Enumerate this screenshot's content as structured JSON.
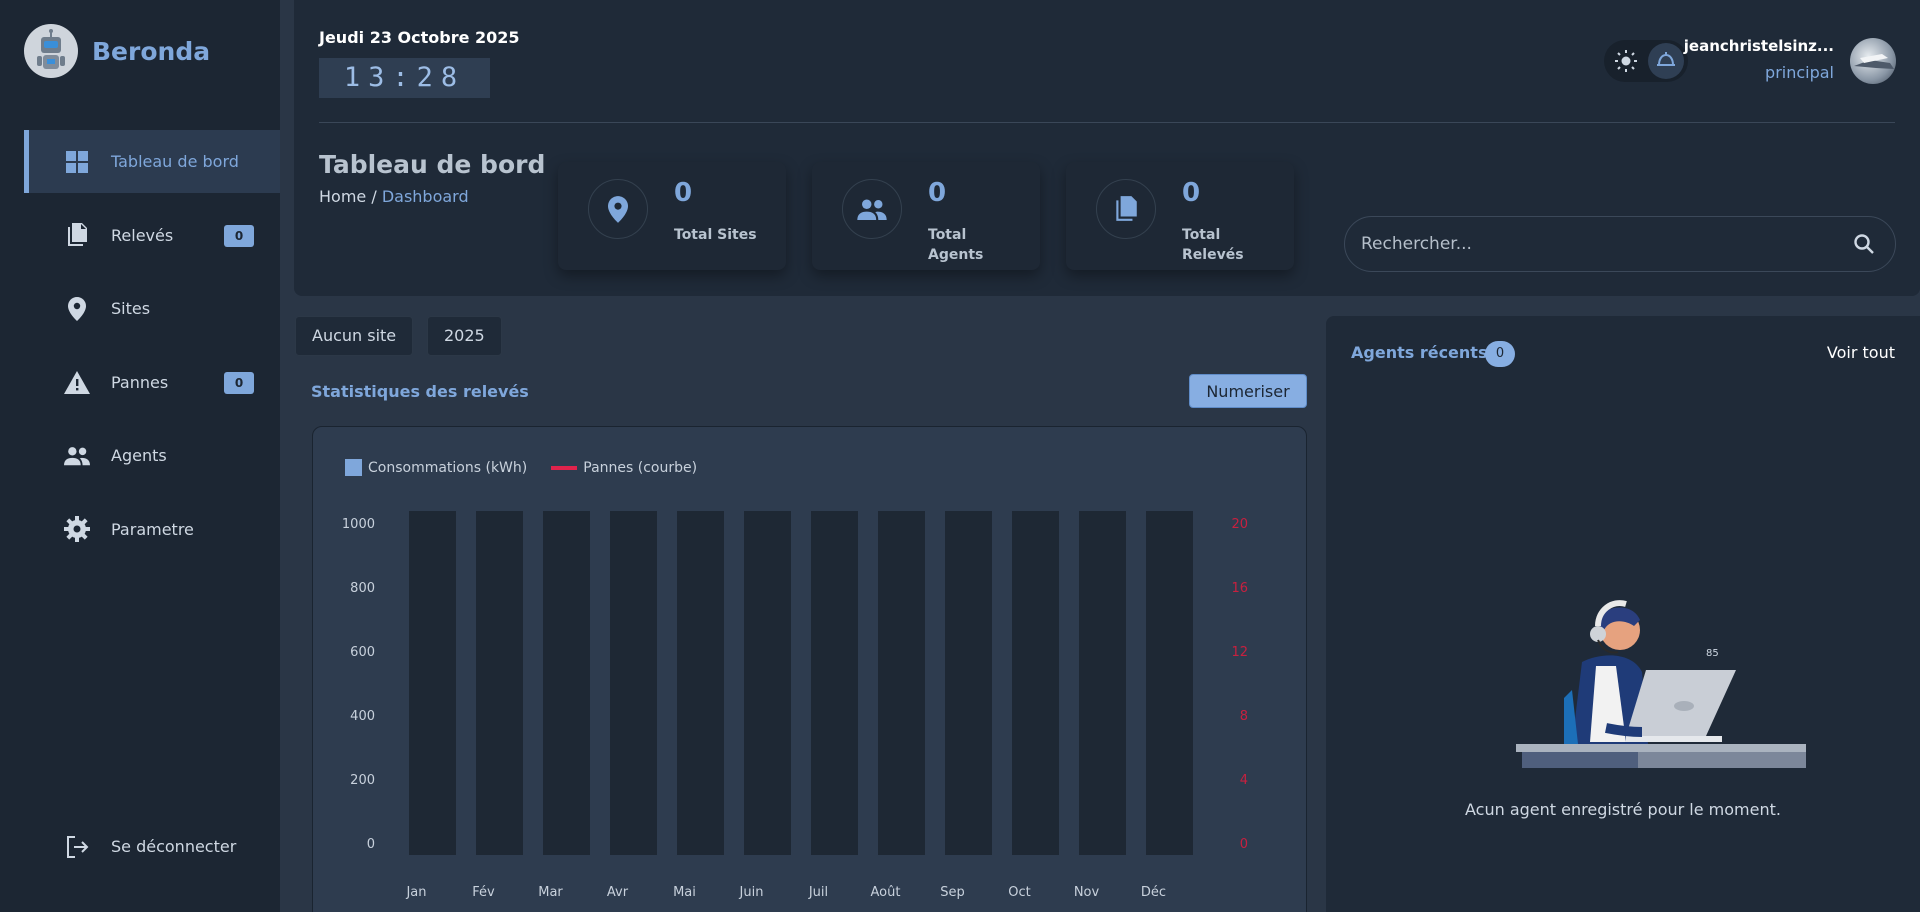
{
  "brand": {
    "name": "Beronda"
  },
  "sidebar": {
    "items": [
      {
        "label": "Tableau de bord",
        "active": true
      },
      {
        "label": "Relevés",
        "badge": "0"
      },
      {
        "label": "Sites"
      },
      {
        "label": "Pannes",
        "badge": "0"
      },
      {
        "label": "Agents"
      },
      {
        "label": "Parametre"
      }
    ],
    "logout": "Se déconnecter"
  },
  "header": {
    "date": "Jeudi 23 Octobre 2025",
    "time": "13:28",
    "user_name": "jeanchristelsinz...",
    "user_role": "principal",
    "page_title": "Tableau de bord",
    "breadcrumb": {
      "home": "Home",
      "sep": " / ",
      "current": "Dashboard"
    }
  },
  "stats": [
    {
      "value": "0",
      "label": "Total Sites",
      "icon": "location-icon"
    },
    {
      "value": "0",
      "label": "Total Agents",
      "icon": "people-icon"
    },
    {
      "value": "0",
      "label": "Total Relevés",
      "icon": "document-icon"
    }
  ],
  "search": {
    "placeholder": "Rechercher..."
  },
  "filters": {
    "site": "Aucun site",
    "year": "2025"
  },
  "section": {
    "stats_title": "Statistiques des relevés",
    "numeriser": "Numeriser"
  },
  "chart_data": {
    "type": "bar",
    "categories": [
      "Jan",
      "Fév",
      "Mar",
      "Avr",
      "Mai",
      "Juin",
      "Juil",
      "Août",
      "Sep",
      "Oct",
      "Nov",
      "Déc"
    ],
    "series": [
      {
        "name": "Consommations (kWh)",
        "values": [
          0,
          0,
          0,
          0,
          0,
          0,
          0,
          0,
          0,
          0,
          0,
          0
        ],
        "axis": "left"
      },
      {
        "name": "Pannes (courbe)",
        "values": [
          0,
          0,
          0,
          0,
          0,
          0,
          0,
          0,
          0,
          0,
          0,
          0
        ],
        "axis": "right"
      }
    ],
    "ylim": [
      0,
      1000
    ],
    "yticks": [
      "0",
      "200",
      "400",
      "600",
      "800",
      "1000"
    ],
    "y2lim": [
      0,
      20
    ],
    "y2ticks": [
      "0",
      "4",
      "8",
      "12",
      "16",
      "20"
    ],
    "legend": "top-left",
    "colors": {
      "bars": "#7fa7db",
      "line": "#e0234c",
      "bar_track": "#1e2834"
    }
  },
  "agents": {
    "title": "Agents récents",
    "count": "0",
    "voir_tout": "Voir tout",
    "empty_message": "Acun agent enregistré pour le moment.",
    "illustration_tag": "85"
  },
  "colors": {
    "accent": "#7fa7db",
    "sidebar_bg": "#1c2633",
    "panel_bg": "#1f2a38",
    "page_bg": "#2a3646"
  }
}
